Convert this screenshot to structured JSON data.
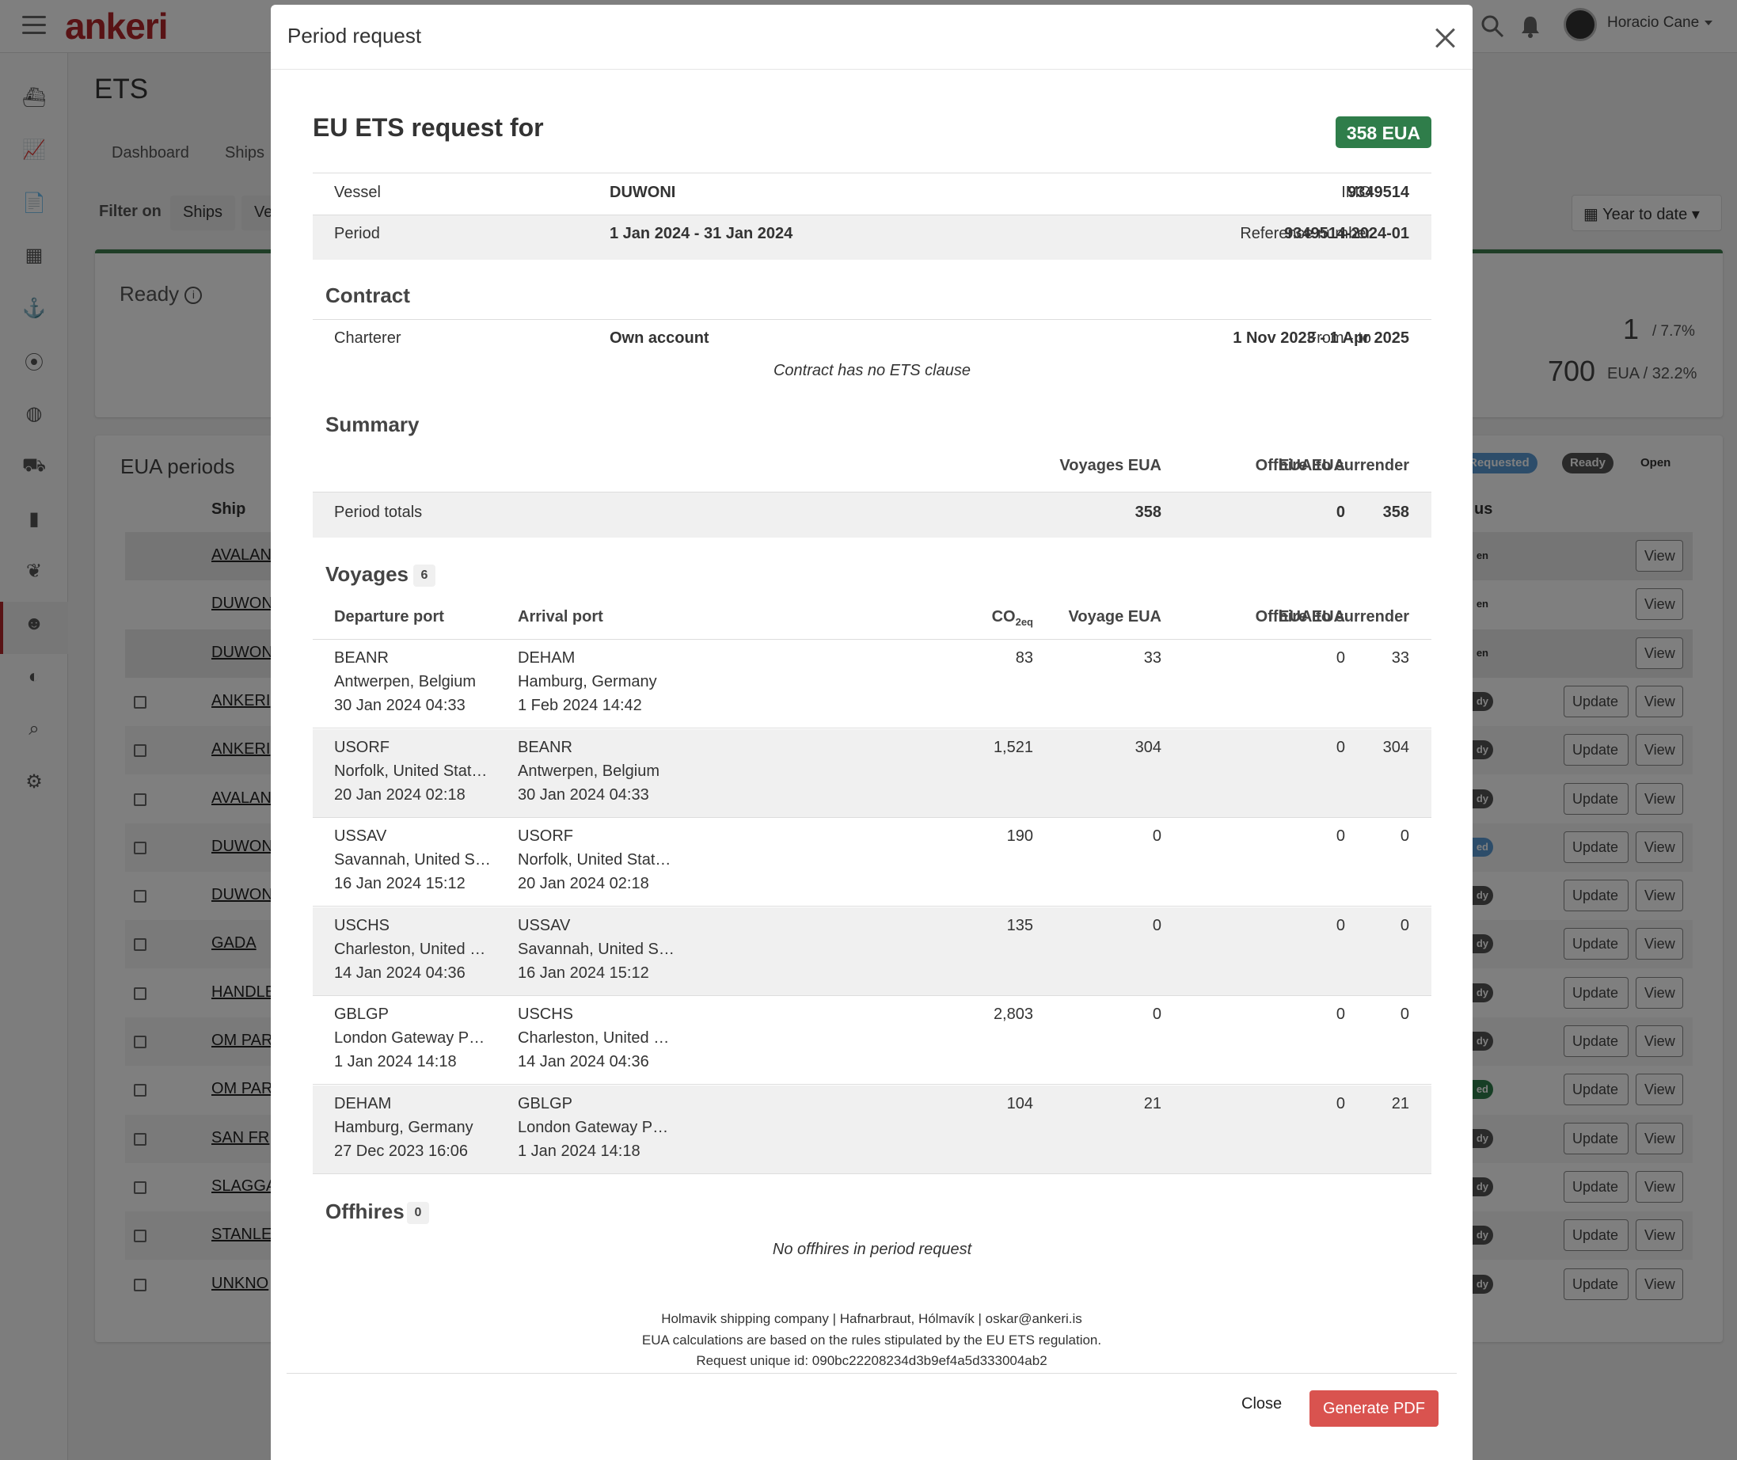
{
  "app": {
    "logo": "ankeri",
    "user_name": "Horacio Cane",
    "page_title": "ETS",
    "tabs": [
      "Dashboard",
      "Ships"
    ],
    "filter_label": "Filter on",
    "filter_chips": [
      "Ships",
      "Ve"
    ],
    "period_select": "Year to date",
    "ready": {
      "title": "Ready",
      "count": "1",
      "count_pct": "/ 7.7%",
      "eua": "700",
      "eua_pct": "EUA / 32.2%"
    },
    "eua_periods": {
      "title": "EUA periods",
      "ship_col": "Ship",
      "status_col": "us",
      "legend": [
        "Requested",
        "Ready",
        "Open"
      ],
      "rows": [
        {
          "ship": "AVALAN",
          "status": "en",
          "has_checkbox": false,
          "has_update": false
        },
        {
          "ship": "DUWON",
          "status": "en",
          "has_checkbox": false,
          "has_update": false
        },
        {
          "ship": "DUWON",
          "status": "en",
          "has_checkbox": false,
          "has_update": false
        },
        {
          "ship": "ANKERI",
          "status": "dy",
          "has_checkbox": true,
          "has_update": true
        },
        {
          "ship": "ANKERI",
          "status": "dy",
          "has_checkbox": true,
          "has_update": true
        },
        {
          "ship": "AVALAN",
          "status": "dy",
          "has_checkbox": true,
          "has_update": true
        },
        {
          "ship": "DUWON",
          "status": "ed",
          "has_checkbox": true,
          "has_update": true
        },
        {
          "ship": "DUWON",
          "status": "dy",
          "has_checkbox": true,
          "has_update": true
        },
        {
          "ship": "GADA",
          "status": "dy",
          "has_checkbox": true,
          "has_update": true
        },
        {
          "ship": "HANDLE",
          "status": "dy",
          "has_checkbox": true,
          "has_update": true
        },
        {
          "ship": "OM PAR",
          "status": "dy",
          "has_checkbox": true,
          "has_update": true
        },
        {
          "ship": "OM PAR",
          "status": "ed",
          "has_checkbox": true,
          "has_update": true
        },
        {
          "ship": "SAN FR",
          "status": "dy",
          "has_checkbox": true,
          "has_update": true
        },
        {
          "ship": "SLAGGA",
          "status": "dy",
          "has_checkbox": true,
          "has_update": true
        },
        {
          "ship": "STANLE",
          "status": "dy",
          "has_checkbox": true,
          "has_update": true
        },
        {
          "ship": "UNKNO",
          "status": "dy",
          "has_checkbox": true,
          "has_update": true
        }
      ],
      "update_label": "Update",
      "view_label": "View"
    },
    "sidebar_icons": [
      "ship-icon",
      "chart-line-icon",
      "document-icon",
      "building-icon",
      "crane-icon",
      "location-icon",
      "globe-icon",
      "cargo-ship-icon",
      "area-chart-icon",
      "leaf-icon",
      "emissions-icon",
      "world-icon",
      "search-analytics-icon",
      "gear-icon"
    ]
  },
  "modal": {
    "header_title": "Period request",
    "request_title": "EU ETS request for",
    "eua_badge": "358 EUA",
    "vessel_label": "Vessel",
    "vessel": "DUWONI",
    "imo_label": "IMO",
    "imo": "9349514",
    "period_label": "Period",
    "period": "1 Jan 2024 - 31 Jan 2024",
    "ref_label": "Reference number",
    "ref": "9349514-2024-01",
    "contract": {
      "title": "Contract",
      "charterer_label": "Charterer",
      "charterer": "Own account",
      "from_to_label": "From - to",
      "from_to": "1 Nov 2023 - 1 Apr 2025",
      "note": "Contract has no ETS clause"
    },
    "summary": {
      "title": "Summary",
      "col_voyages": "Voyages EUA",
      "col_offhire": "Offhire EUA",
      "col_surrender": "EUA to surrender",
      "row_label": "Period totals",
      "voyages": "358",
      "offhire": "0",
      "surrender": "358"
    },
    "voyages": {
      "title": "Voyages",
      "count": "6",
      "col_departure": "Departure port",
      "col_arrival": "Arrival port",
      "col_co2": "CO",
      "col_co2_sub": "2eq",
      "col_voyage_eua": "Voyage EUA",
      "col_offhire": "Offhire EUA",
      "col_surrender": "EUA to surrender",
      "rows": [
        {
          "dep_code": "BEANR",
          "dep_name": "Antwerpen, Belgium",
          "dep_time": "30 Jan 2024 04:33",
          "arr_code": "DEHAM",
          "arr_name": "Hamburg, Germany",
          "arr_time": "1 Feb 2024 14:42",
          "co2": "83",
          "voyage_eua": "33",
          "offhire": "0",
          "surrender": "33"
        },
        {
          "dep_code": "USORF",
          "dep_name": "Norfolk, United Stat…",
          "dep_time": "20 Jan 2024 02:18",
          "arr_code": "BEANR",
          "arr_name": "Antwerpen, Belgium",
          "arr_time": "30 Jan 2024 04:33",
          "co2": "1,521",
          "voyage_eua": "304",
          "offhire": "0",
          "surrender": "304"
        },
        {
          "dep_code": "USSAV",
          "dep_name": "Savannah, United S…",
          "dep_time": "16 Jan 2024 15:12",
          "arr_code": "USORF",
          "arr_name": "Norfolk, United Stat…",
          "arr_time": "20 Jan 2024 02:18",
          "co2": "190",
          "voyage_eua": "0",
          "offhire": "0",
          "surrender": "0"
        },
        {
          "dep_code": "USCHS",
          "dep_name": "Charleston, United …",
          "dep_time": "14 Jan 2024 04:36",
          "arr_code": "USSAV",
          "arr_name": "Savannah, United S…",
          "arr_time": "16 Jan 2024 15:12",
          "co2": "135",
          "voyage_eua": "0",
          "offhire": "0",
          "surrender": "0"
        },
        {
          "dep_code": "GBLGP",
          "dep_name": "London Gateway P…",
          "dep_time": "1 Jan 2024 14:18",
          "arr_code": "USCHS",
          "arr_name": "Charleston, United …",
          "arr_time": "14 Jan 2024 04:36",
          "co2": "2,803",
          "voyage_eua": "0",
          "offhire": "0",
          "surrender": "0"
        },
        {
          "dep_code": "DEHAM",
          "dep_name": "Hamburg, Germany",
          "dep_time": "27 Dec 2023 16:06",
          "arr_code": "GBLGP",
          "arr_name": "London Gateway P…",
          "arr_time": "1 Jan 2024 14:18",
          "co2": "104",
          "voyage_eua": "21",
          "offhire": "0",
          "surrender": "21"
        }
      ]
    },
    "offhires": {
      "title": "Offhires",
      "count": "0",
      "note": "No offhires in period request"
    },
    "footer": {
      "line1": "Holmavik shipping company | Hafnarbraut, Hólmavík | oskar@ankeri.is",
      "line2": "EUA calculations are based on the rules stipulated by the EU ETS regulation.",
      "line3": "Request unique id: 090bc22208234d3b9ef4a5d333004ab2"
    },
    "close_label": "Close",
    "pdf_label": "Generate PDF"
  },
  "colors": {
    "brand": "#b3262b",
    "badge_green": "#2f7d4a",
    "pdf_red": "#d9534f"
  }
}
